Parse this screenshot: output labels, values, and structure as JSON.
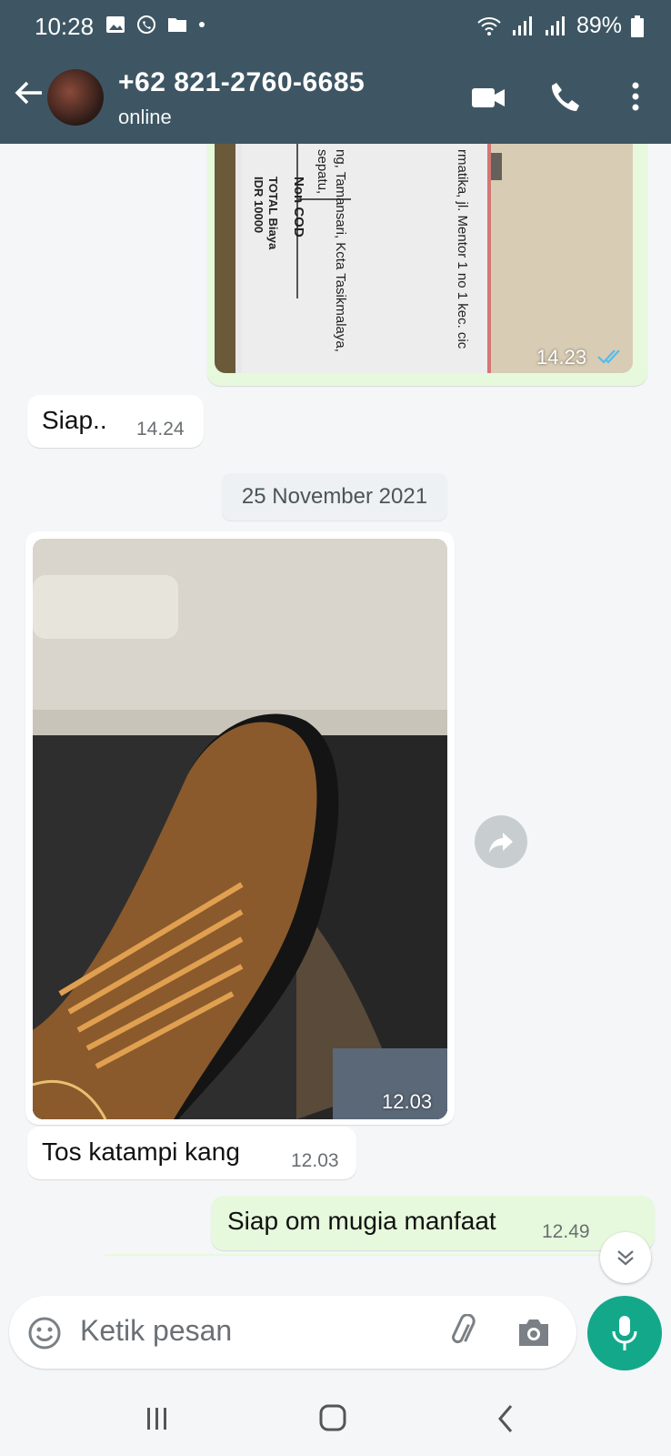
{
  "status_bar": {
    "time": "10:28",
    "battery": "89%"
  },
  "header": {
    "contact": "+62 821-2760-6685",
    "status": "online"
  },
  "messages": {
    "receipt_time": "14.23",
    "siap_text": "Siap..",
    "siap_time": "14.24",
    "date": "25 November 2021",
    "shoe_time": "12.03",
    "tos_text": "Tos katampi kang",
    "tos_time": "12.03",
    "out_text": "Siap om mugia manfaat",
    "out_time": "12.49"
  },
  "receipt_text": {
    "line1": "rmatika, jl. Mentor 1 no 1 kec. cic",
    "line2": "ng, Tamansari, Kcta Tasikmalaya,",
    "line3": "sepatu,",
    "cod": "Non COD",
    "total": "TOTAL Biaya",
    "amount": "IDR 10000"
  },
  "input": {
    "placeholder": "Ketik pesan"
  },
  "colors": {
    "header": "#3e5663",
    "outgoing_bubble": "#e7f9dc",
    "accent": "#14a88a",
    "read_ticks": "#53bdeb"
  },
  "icons": [
    "back-arrow-icon",
    "video-call-icon",
    "phone-icon",
    "more-icon",
    "emoji-icon",
    "attach-icon",
    "camera-icon",
    "mic-icon",
    "forward-icon",
    "scroll-down-icon"
  ]
}
